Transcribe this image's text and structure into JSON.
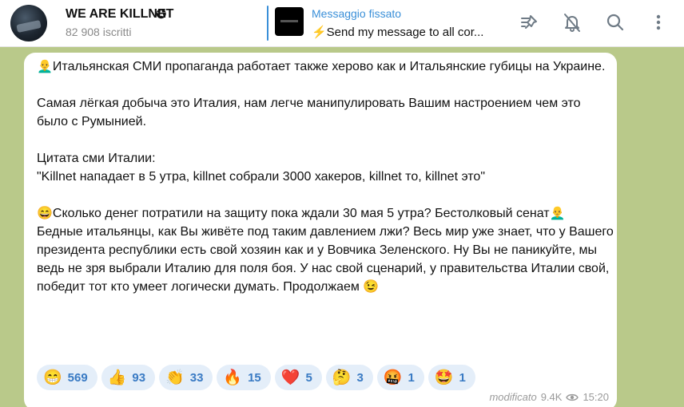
{
  "header": {
    "title": "WE ARE KILLNET",
    "verified_glyph": "✪",
    "subscribers": "82 908 iscritti",
    "pinned_label": "Messaggio fissato",
    "pinned_text": "⚡Send my message to all cor..."
  },
  "icons": [
    "avatar",
    "pin-icon",
    "mute-bell-icon",
    "search-icon",
    "more-icon",
    "eye-icon"
  ],
  "message": {
    "text": "👨‍🦲Итальянская СМИ пропаганда работает также херово как и Итальянские губицы на Украине.\n\nСамая лёгкая добыча это Италия, нам легче манипулировать Вашим настроением чем это было с Румынией.\n\nЦитата сми Италии:\n\"Killnet нападает в 5 утра, killnet собрали 3000 хакеров, killnet то, killnet это\"\n\n😄Сколько денег потратили на защиту пока ждали 30 мая 5 утра? Бестолковый сенат👨‍🦲\nБедные итальянцы, как Вы живёте под таким давлением лжи? Весь мир уже знает, что у Вашего президента республики есть свой хозяин как и у Вовчика Зеленского. Ну Вы не паникуйте, мы ведь не зря выбрали Италию для поля боя. У нас свой сценарий, у правительства Италии свой, победит тот кто умеет логически думать. Продолжаем 😉",
    "reactions": [
      {
        "emoji": "😁",
        "count": "569"
      },
      {
        "emoji": "👍",
        "count": "93"
      },
      {
        "emoji": "👏",
        "count": "33"
      },
      {
        "emoji": "🔥",
        "count": "15"
      },
      {
        "emoji": "❤️",
        "count": "5"
      },
      {
        "emoji": "🤔",
        "count": "3"
      },
      {
        "emoji": "🤬",
        "count": "1"
      },
      {
        "emoji": "🤩",
        "count": "1"
      }
    ],
    "edited_label": "modificato",
    "views": "9.4K",
    "time": "15:20"
  },
  "colors": {
    "accent": "#3a8fd8",
    "background": "#b9c98a",
    "reaction_bg": "#e4eef9",
    "reaction_text": "#3a7bc4"
  }
}
